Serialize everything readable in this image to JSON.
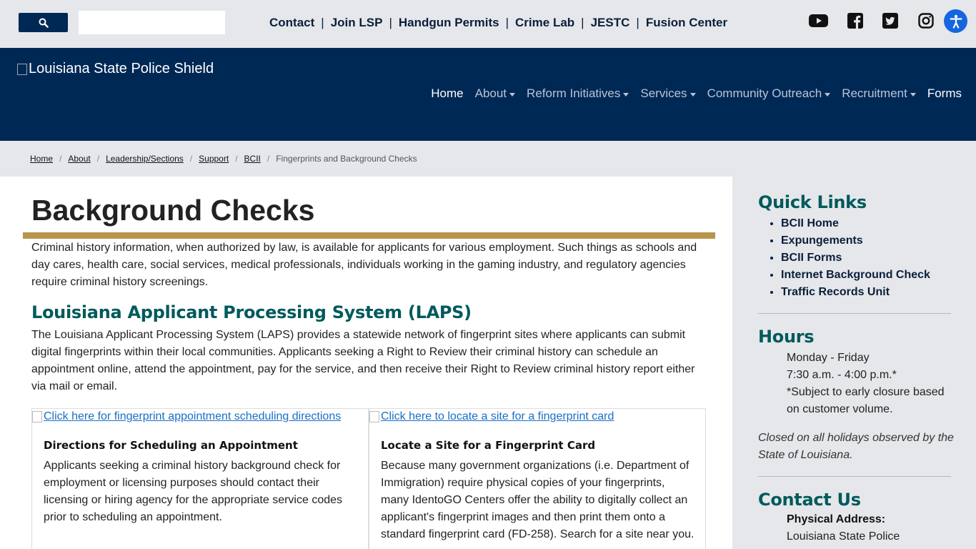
{
  "utility_bar": {
    "search_placeholder": "",
    "links": [
      "Contact",
      "Join LSP",
      "Handgun Permits",
      "Crime Lab",
      "JESTC",
      "Fusion Center"
    ],
    "separator": "|",
    "social_icons": [
      "youtube-icon",
      "facebook-icon",
      "twitter-icon",
      "instagram-icon"
    ],
    "accessibility_icon": "accessibility-icon"
  },
  "header": {
    "logo_alt": "Louisiana State Police Shield",
    "nav": [
      {
        "label": "Home",
        "dropdown": false,
        "active": true
      },
      {
        "label": "About",
        "dropdown": true,
        "active": false
      },
      {
        "label": "Reform Initiatives",
        "dropdown": true,
        "active": false
      },
      {
        "label": "Services",
        "dropdown": true,
        "active": false
      },
      {
        "label": "Community Outreach",
        "dropdown": true,
        "active": false
      },
      {
        "label": "Recruitment",
        "dropdown": true,
        "active": false
      },
      {
        "label": "Forms",
        "dropdown": false,
        "active": true
      }
    ]
  },
  "breadcrumb": {
    "links": [
      "Home",
      "About",
      "Leadership/Sections",
      "Support",
      "BCII"
    ],
    "current": "Fingerprints and Background Checks",
    "separator": "/"
  },
  "main": {
    "title": "Background Checks",
    "intro": "Criminal history information, when authorized by law, is available for applicants for various employment. Such things as schools and day cares, health care, social services, medical professionals, individuals working in the gaming industry, and regulatory agencies require criminal history screenings.",
    "laps_heading": "Louisiana Applicant Processing System (LAPS)",
    "laps_text": "The Louisiana Applicant Processing System (LAPS) provides a statewide network of fingerprint sites where applicants can submit digital fingerprints within their local communities. Applicants seeking a Right to Review their criminal history can schedule an appointment online, attend the appointment, pay for the service, and then receive their Right to Review criminal history report either via mail or email.",
    "cards": [
      {
        "image_alt": "Click here for fingerprint appointment scheduling directions",
        "title": "Directions for Scheduling an Appointment",
        "body": "Applicants seeking a criminal history background check for employment or licensing purposes should contact their licensing or hiring agency for the appropriate service codes prior to scheduling an appointment."
      },
      {
        "image_alt": "Click here to locate a site for a fingerprint card",
        "title": "Locate a Site for a Fingerprint Card",
        "body": "Because many government organizations (i.e. Department of Immigration) require physical copies of your fingerprints, many IdentoGO Centers offer the ability to digitally collect an applicant's fingerprint images and then print them onto a standard fingerprint card (FD-258). Search for a site near you."
      }
    ]
  },
  "sidebar": {
    "quick_links_title": "Quick Links",
    "quick_links": [
      "BCII Home",
      "Expungements",
      "BCII Forms",
      "Internet Background Check",
      "Traffic Records Unit"
    ],
    "hours_title": "Hours",
    "hours_lines": [
      "Monday - Friday",
      "7:30 a.m. - 4:00 p.m.*",
      "*Subject to early closure based",
      "on customer volume."
    ],
    "closed_note": "Closed on all holidays observed by the State of Louisiana.",
    "contact_title": "Contact Us",
    "address_label": "Physical Address:",
    "address_line1": "Louisiana State Police"
  },
  "colors": {
    "navy": "#002855",
    "teal_heading": "#005a5b",
    "gold_rule": "#b8954a",
    "link_blue": "#1a6fc4",
    "panel_gray": "#e5e7eb"
  }
}
